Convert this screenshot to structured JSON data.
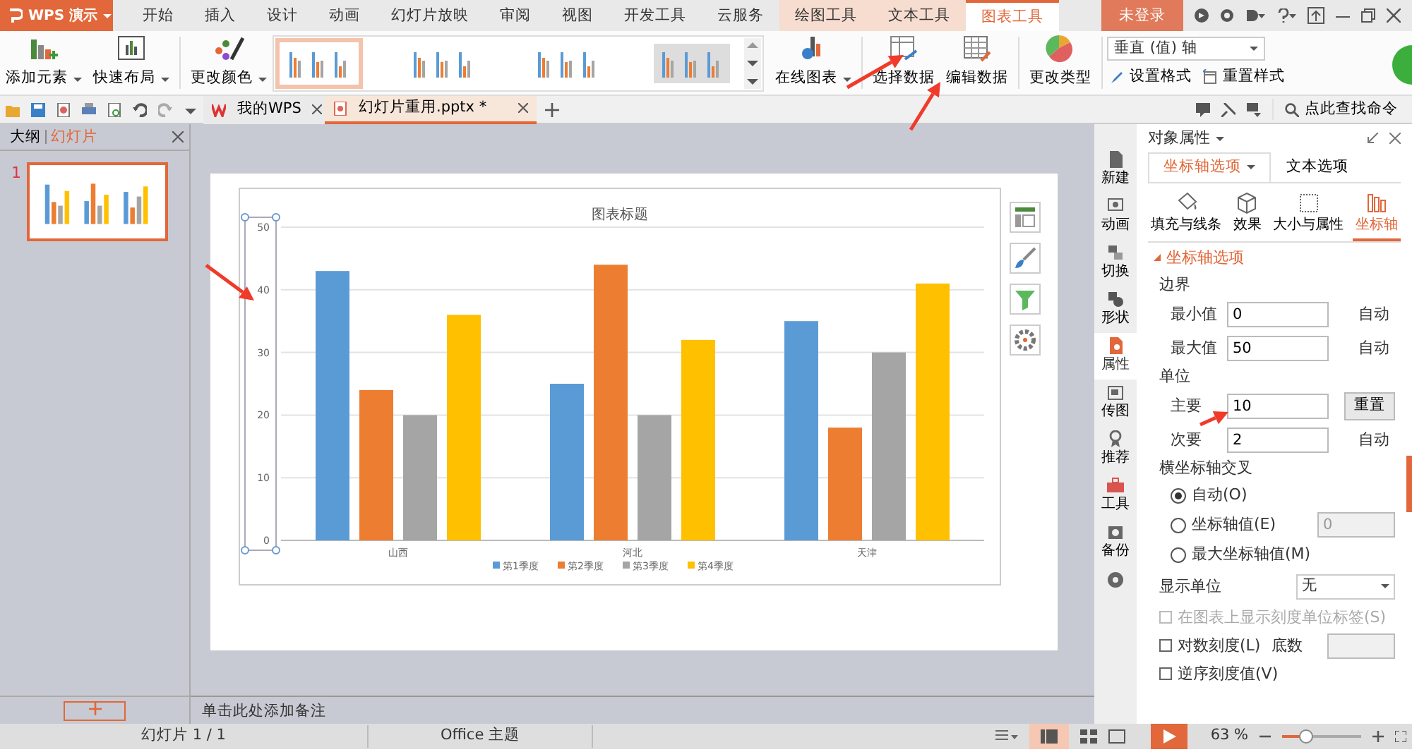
{
  "app_button": {
    "label": "WPS 演示"
  },
  "menu_tabs": [
    {
      "label": "开始",
      "selected": false
    },
    {
      "label": "插入",
      "selected": false
    },
    {
      "label": "设计",
      "selected": false
    },
    {
      "label": "动画",
      "selected": false
    },
    {
      "label": "幻灯片放映",
      "selected": false
    },
    {
      "label": "审阅",
      "selected": false
    },
    {
      "label": "视图",
      "selected": false
    },
    {
      "label": "开发工具",
      "selected": false
    },
    {
      "label": "云服务",
      "selected": false
    }
  ],
  "tool_tabs": [
    {
      "label": "绘图工具",
      "selected": false
    },
    {
      "label": "文本工具",
      "selected": false
    },
    {
      "label": "图表工具",
      "selected": true
    }
  ],
  "login": "未登录",
  "ribbon": {
    "left_buttons": [
      {
        "label": "添加元素",
        "dropdown": true
      },
      {
        "label": "快速布局",
        "dropdown": true
      },
      {
        "label": "更改颜色",
        "dropdown": true
      }
    ],
    "styles": [
      {
        "selected": true
      },
      {
        "selected": false
      },
      {
        "selected": false
      },
      {
        "selected": false
      }
    ],
    "right_buttons": [
      {
        "label": "在线图表",
        "dropdown": true
      },
      {
        "label": "选择数据",
        "dropdown": false
      },
      {
        "label": "编辑数据",
        "dropdown": false
      },
      {
        "label": "更改类型",
        "dropdown": false
      }
    ],
    "element_select": "垂直 (值) 轴",
    "format_button": "设置格式",
    "reset_button": "重置样式"
  },
  "doc_tabs": [
    {
      "label": "我的WPS",
      "selected": false
    },
    {
      "label": "幻灯片重用.pptx *",
      "selected": true
    }
  ],
  "search_label": "点此查找命令",
  "left_panel": {
    "tabs": [
      {
        "label": "大纲",
        "selected": false
      },
      {
        "label": "幻灯片",
        "selected": true
      }
    ],
    "slides": [
      {
        "number": "1",
        "selected": true
      }
    ]
  },
  "chart": {
    "chart_data": {
      "type": "bar",
      "title": "图表标题",
      "categories": [
        "山西",
        "河北",
        "天津"
      ],
      "series": [
        {
          "name": "第1季度",
          "color": "#5b9bd5",
          "values": [
            43,
            25,
            35
          ]
        },
        {
          "name": "第2季度",
          "color": "#ed7d31",
          "values": [
            24,
            44,
            18
          ]
        },
        {
          "name": "第3季度",
          "color": "#a5a5a5",
          "values": [
            20,
            20,
            30
          ]
        },
        {
          "name": "第4季度",
          "color": "#ffc000",
          "values": [
            36,
            32,
            41
          ]
        }
      ],
      "ylim": [
        0,
        50
      ],
      "yticks": [
        0,
        10,
        20,
        30,
        40,
        50
      ],
      "grid": true,
      "legend": "bottom"
    }
  },
  "notes_placeholder": "单击此处添加备注",
  "side_rail": [
    {
      "label": "新建",
      "selected": false
    },
    {
      "label": "动画",
      "selected": false
    },
    {
      "label": "切换",
      "selected": false
    },
    {
      "label": "形状",
      "selected": false
    },
    {
      "label": "属性",
      "selected": true
    },
    {
      "label": "传图",
      "selected": false
    },
    {
      "label": "推荐",
      "selected": false
    },
    {
      "label": "工具",
      "selected": false
    },
    {
      "label": "备份",
      "selected": false
    }
  ],
  "properties": {
    "title": "对象属性",
    "tabs": [
      {
        "label": "坐标轴选项",
        "selected": true
      },
      {
        "label": "文本选项",
        "selected": false
      }
    ],
    "subtabs": [
      {
        "label": "填充与线条",
        "selected": false
      },
      {
        "label": "效果",
        "selected": false
      },
      {
        "label": "大小与属性",
        "selected": false
      },
      {
        "label": "坐标轴",
        "selected": true
      }
    ],
    "section": "坐标轴选项",
    "rows": [
      {
        "kind": "heading",
        "label": "边界"
      },
      {
        "kind": "number",
        "label": "最小值",
        "value": "0",
        "action": "自动"
      },
      {
        "kind": "number",
        "label": "最大值",
        "value": "50",
        "action": "自动"
      },
      {
        "kind": "heading",
        "label": "单位"
      },
      {
        "kind": "number",
        "label": "主要",
        "value": "10",
        "button": "重置"
      },
      {
        "kind": "number",
        "label": "次要",
        "value": "2",
        "action": "自动"
      },
      {
        "kind": "heading",
        "label": "横坐标轴交叉"
      },
      {
        "kind": "radio",
        "label": "自动(O)",
        "selected": true
      },
      {
        "kind": "radio",
        "label": "坐标轴值(E)",
        "selected": false,
        "value": "0"
      },
      {
        "kind": "radio",
        "label": "最大坐标轴值(M)",
        "selected": false
      },
      {
        "kind": "select",
        "label": "显示单位",
        "value": "无"
      },
      {
        "kind": "checkbox",
        "label": "在图表上显示刻度单位标签(S)",
        "checked": false,
        "disabled": true
      },
      {
        "kind": "checkbox",
        "label": "对数刻度(L)",
        "checked": false,
        "disabled": false,
        "base_label": "底数"
      },
      {
        "kind": "checkbox",
        "label": "逆序刻度值(V)",
        "checked": false,
        "disabled": false
      }
    ]
  },
  "status": {
    "slide_info": "幻灯片 1 / 1",
    "theme": "Office 主题",
    "zoom": "63 %",
    "zoom_slider": {
      "level": 0.3
    }
  }
}
